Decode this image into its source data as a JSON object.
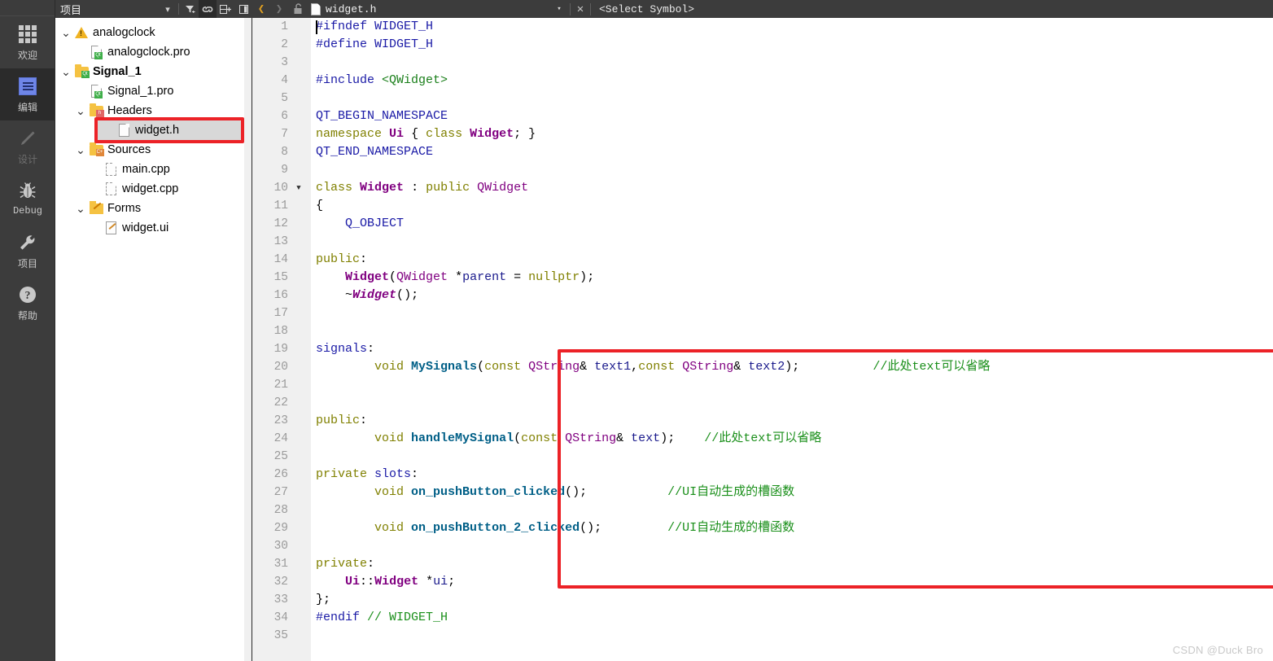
{
  "activity_bar": {
    "items": [
      {
        "label": "欢迎",
        "icon": "grid-icon",
        "state": "normal",
        "name": "welcome"
      },
      {
        "label": "编辑",
        "icon": "edit-icon",
        "state": "selected",
        "name": "edit"
      },
      {
        "label": "设计",
        "icon": "pencil-icon",
        "state": "disabled",
        "name": "design"
      },
      {
        "label": "Debug",
        "icon": "bug-icon",
        "state": "normal",
        "name": "debug"
      },
      {
        "label": "项目",
        "icon": "wrench-icon",
        "state": "normal",
        "name": "projects"
      },
      {
        "label": "帮助",
        "icon": "help-icon",
        "state": "normal",
        "name": "help"
      }
    ]
  },
  "project_panel": {
    "title": "项目",
    "toolbar": [
      {
        "name": "dropdown-chevron-icon",
        "glyph": "▾",
        "active": false
      },
      {
        "name": "filter-icon",
        "glyph": "⧩",
        "active": false
      },
      {
        "name": "link-sync-icon",
        "glyph": "⛓",
        "active": true
      },
      {
        "name": "split-add-icon",
        "glyph": "⊟",
        "active": false
      },
      {
        "name": "collapse-panel-icon",
        "glyph": "◨",
        "active": false
      }
    ],
    "tree": [
      {
        "label": "analogclock",
        "indent": 0,
        "arrow": "v",
        "icon": "warning-icon",
        "bold": false,
        "selected": false
      },
      {
        "label": "analogclock.pro",
        "indent": 1,
        "arrow": "",
        "icon": "pro-file-icon",
        "bold": false,
        "selected": false
      },
      {
        "label": "Signal_1",
        "indent": 0,
        "arrow": "v",
        "icon": "qt-folder-icon",
        "bold": true,
        "selected": false
      },
      {
        "label": "Signal_1.pro",
        "indent": 1,
        "arrow": "",
        "icon": "pro-file-icon",
        "bold": false,
        "selected": false
      },
      {
        "label": "Headers",
        "indent": 1,
        "arrow": "v",
        "icon": "h-folder-icon",
        "bold": false,
        "selected": false
      },
      {
        "label": "widget.h",
        "indent": 2,
        "arrow": "",
        "icon": "header-file-icon",
        "bold": false,
        "selected": true
      },
      {
        "label": "Sources",
        "indent": 1,
        "arrow": "v",
        "icon": "cpp-folder-icon",
        "bold": false,
        "selected": false
      },
      {
        "label": "main.cpp",
        "indent": 2,
        "arrow": "",
        "icon": "cpp-file-icon",
        "bold": false,
        "selected": false
      },
      {
        "label": "widget.cpp",
        "indent": 2,
        "arrow": "",
        "icon": "cpp-file-icon",
        "bold": false,
        "selected": false
      },
      {
        "label": "Forms",
        "indent": 1,
        "arrow": "v",
        "icon": "forms-folder-icon",
        "bold": false,
        "selected": false
      },
      {
        "label": "widget.ui",
        "indent": 2,
        "arrow": "",
        "icon": "ui-file-icon",
        "bold": false,
        "selected": false
      }
    ]
  },
  "editor_toolbar": {
    "back_glyph": "❮",
    "forward_glyph": "❯",
    "lock_icon": "unlocked-padlock-icon",
    "filename": "widget.h",
    "dropdown_glyph": "▾",
    "close_glyph": "✕",
    "symbol_selector": "<Select Symbol>"
  },
  "editor": {
    "first_line": 1,
    "last_line": 35,
    "fold_marker_line": 10,
    "cursor_line": 1,
    "cursor_column": 1,
    "lines": [
      {
        "n": 1,
        "text": "#ifndef WIDGET_H"
      },
      {
        "n": 2,
        "text": "#define WIDGET_H"
      },
      {
        "n": 3,
        "text": ""
      },
      {
        "n": 4,
        "text": "#include <QWidget>"
      },
      {
        "n": 5,
        "text": ""
      },
      {
        "n": 6,
        "text": "QT_BEGIN_NAMESPACE"
      },
      {
        "n": 7,
        "text": "namespace Ui { class Widget; }"
      },
      {
        "n": 8,
        "text": "QT_END_NAMESPACE"
      },
      {
        "n": 9,
        "text": ""
      },
      {
        "n": 10,
        "text": "class Widget : public QWidget"
      },
      {
        "n": 11,
        "text": "{"
      },
      {
        "n": 12,
        "text": "    Q_OBJECT"
      },
      {
        "n": 13,
        "text": ""
      },
      {
        "n": 14,
        "text": "public:"
      },
      {
        "n": 15,
        "text": "    Widget(QWidget *parent = nullptr);"
      },
      {
        "n": 16,
        "text": "    ~Widget();"
      },
      {
        "n": 17,
        "text": ""
      },
      {
        "n": 18,
        "text": ""
      },
      {
        "n": 19,
        "text": "signals:"
      },
      {
        "n": 20,
        "text": "        void MySignals(const QString& text1,const QString& text2);          //此处text可以省略"
      },
      {
        "n": 21,
        "text": ""
      },
      {
        "n": 22,
        "text": ""
      },
      {
        "n": 23,
        "text": "public:"
      },
      {
        "n": 24,
        "text": "        void handleMySignal(const QString& text);    //此处text可以省略"
      },
      {
        "n": 25,
        "text": ""
      },
      {
        "n": 26,
        "text": "private slots:"
      },
      {
        "n": 27,
        "text": "        void on_pushButton_clicked();           //UI自动生成的槽函数"
      },
      {
        "n": 28,
        "text": ""
      },
      {
        "n": 29,
        "text": "        void on_pushButton_2_clicked();         //UI自动生成的槽函数"
      },
      {
        "n": 30,
        "text": ""
      },
      {
        "n": 31,
        "text": "private:"
      },
      {
        "n": 32,
        "text": "    Ui::Widget *ui;"
      },
      {
        "n": 33,
        "text": "};"
      },
      {
        "n": 34,
        "text": "#endif // WIDGET_H"
      },
      {
        "n": 35,
        "text": ""
      }
    ]
  },
  "annotations": {
    "tree_box_target": "widget.h",
    "code_box_first_line": 19,
    "code_box_last_line": 31,
    "box_color": "#ec2227"
  },
  "watermark": {
    "text": "CSDN @Duck Bro"
  },
  "colors": {
    "chrome_bg": "#3c3c3c",
    "activity_bg": "#3c3c3c",
    "activity_selected_bg": "#2b2b2b",
    "editor_bg": "#ffffff",
    "gutter_bg": "#f0f0f0",
    "gutter_fg": "#9a9a9a",
    "tree_selected_bg": "#d8d8d8",
    "accent_red": "#ec2227",
    "token_preprocessor": "#1a1aa6",
    "token_string": "#1a7f1a",
    "token_keyword": "#808000",
    "token_type": "#800080",
    "token_function": "#005f87",
    "token_variable": "#1a1a8c",
    "token_comment": "#1a8f1a"
  }
}
